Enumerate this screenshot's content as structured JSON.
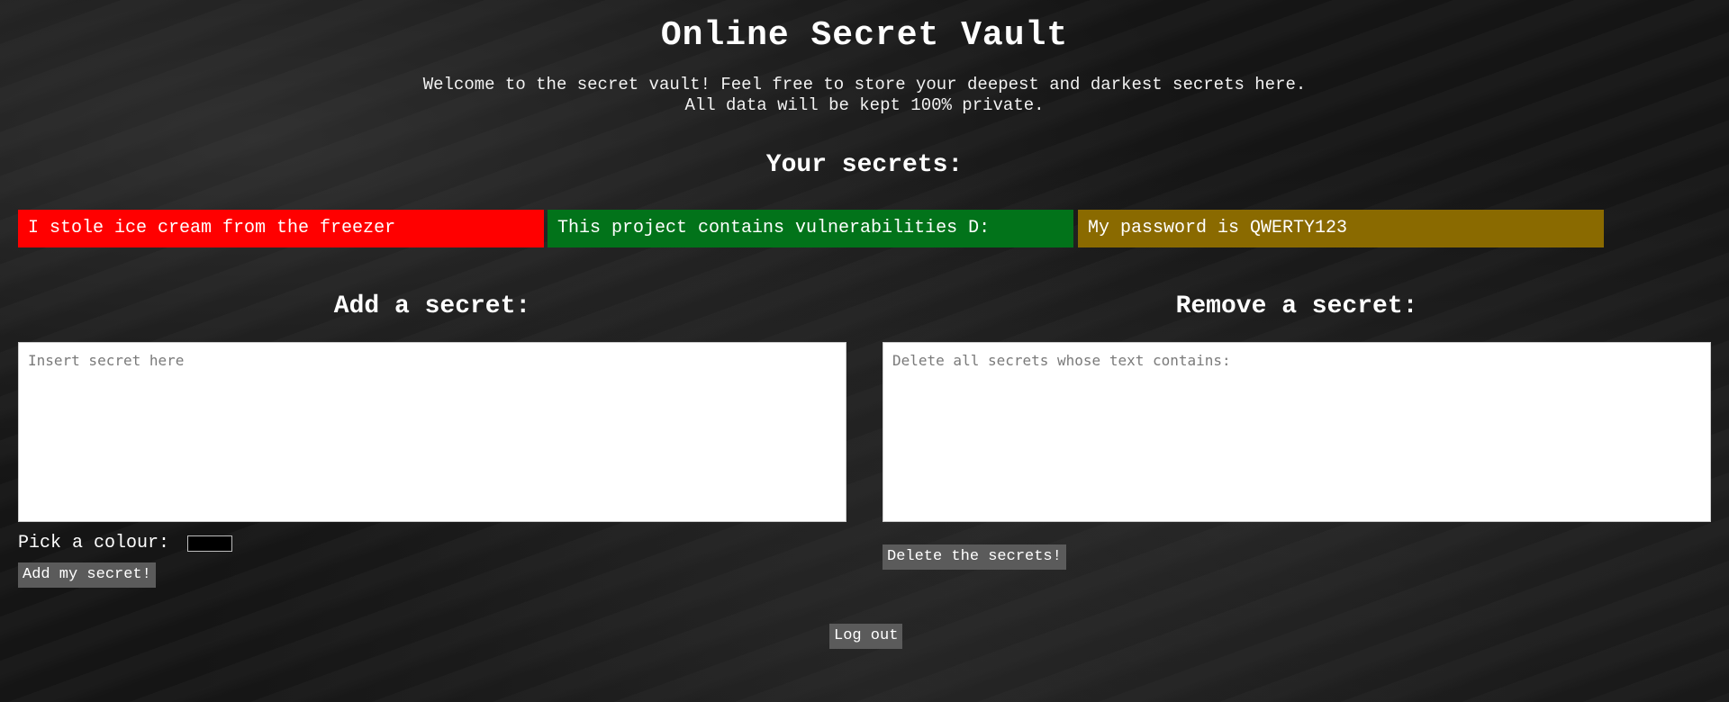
{
  "header": {
    "title": "Online Secret Vault",
    "welcome_line_1": "Welcome to the secret vault! Feel free to store your deepest and darkest secrets here.",
    "welcome_line_2": "All data will be kept 100% private."
  },
  "secrets": {
    "heading": "Your secrets:",
    "items": [
      {
        "text": "I stole ice cream from the freezer",
        "color": "#ff0000"
      },
      {
        "text": "This project contains vulnerabilities D:",
        "color": "#02731a"
      },
      {
        "text": "My password is QWERTY123",
        "color": "#8a6a00"
      }
    ]
  },
  "add_section": {
    "heading": "Add a secret:",
    "textarea_placeholder": "Insert secret here",
    "colour_label": "Pick a colour:",
    "colour_value": "#000000",
    "submit_label": "Add my secret!"
  },
  "remove_section": {
    "heading": "Remove a secret:",
    "textarea_placeholder": "Delete all secrets whose text contains:",
    "submit_label": "Delete the secrets!"
  },
  "logout_label": "Log out"
}
